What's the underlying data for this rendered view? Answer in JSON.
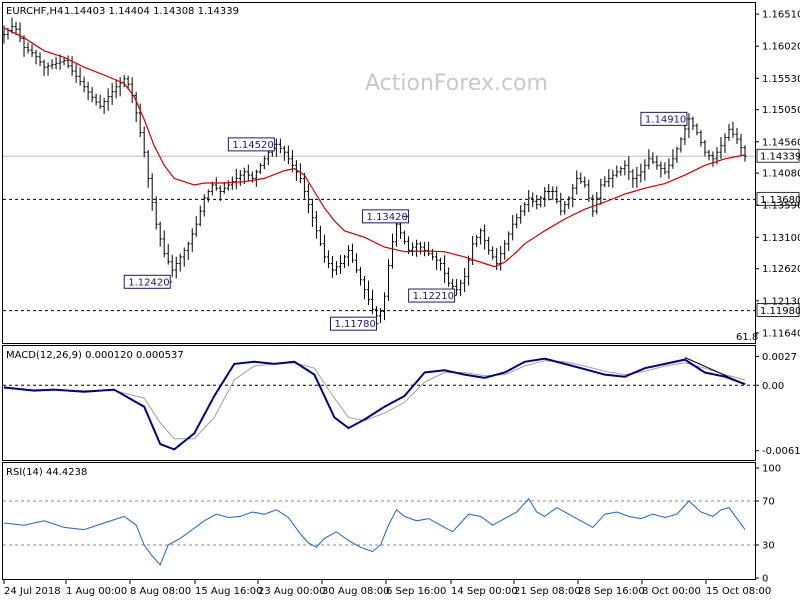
{
  "header": {
    "symbol": "EURCHF,H4",
    "ohlc": "1.14403 1.14404 1.14308 1.14339",
    "macd_label": "MACD(12,26,9) 0.000120 0.000537",
    "rsi_label": "RSI(14) 44.4238"
  },
  "watermark": "ActionForex.com",
  "colors": {
    "price_bar": "#000000",
    "ma": "#cc0000",
    "macd_main": "#000080",
    "macd_signal": "#a0a0a0",
    "rsi": "#1e64c8",
    "label_border": "#1a1a6e",
    "grid_dashed": "#000000"
  },
  "chart_data": [
    {
      "type": "ohlc",
      "title": "EURCHF,H4",
      "y_ticks": [
        "1.16510",
        "1.16020",
        "1.15530",
        "1.15050",
        "1.14560",
        "1.14080",
        "1.13590",
        "1.13100",
        "1.12620",
        "1.12130",
        "1.11640"
      ],
      "y_range": [
        1.115,
        1.1665
      ],
      "current_price": {
        "value": 1.14339,
        "label": "1.14339"
      },
      "horizontal_levels": [
        {
          "value": 1.1368,
          "label": "1.13680"
        },
        {
          "value": 1.1198,
          "label": "1.11980"
        }
      ],
      "annotations": [
        {
          "label": "1.14520",
          "value": 1.1452
        },
        {
          "label": "1.12420",
          "value": 1.1242
        },
        {
          "label": "1.13420",
          "value": 1.1342
        },
        {
          "label": "1.11780",
          "value": 1.1178
        },
        {
          "label": "1.12210",
          "value": 1.1221
        },
        {
          "label": "1.14910",
          "value": 1.1491
        }
      ],
      "fib_label": "61.8",
      "close_path": [
        [
          0,
          1.162
        ],
        [
          5,
          1.1635
        ],
        [
          10,
          1.16
        ],
        [
          15,
          1.159
        ],
        [
          20,
          1.157
        ],
        [
          25,
          1.1575
        ],
        [
          30,
          1.158
        ],
        [
          35,
          1.156
        ],
        [
          40,
          1.154
        ],
        [
          45,
          1.152
        ],
        [
          48,
          1.151
        ],
        [
          52,
          1.1525
        ],
        [
          56,
          1.154
        ],
        [
          60,
          1.1552
        ],
        [
          63,
          1.154
        ],
        [
          66,
          1.15
        ],
        [
          70,
          1.144
        ],
        [
          73,
          1.138
        ],
        [
          76,
          1.133
        ],
        [
          80,
          1.1285
        ],
        [
          84,
          1.126
        ],
        [
          88,
          1.128
        ],
        [
          92,
          1.13
        ],
        [
          96,
          1.133
        ],
        [
          100,
          1.137
        ],
        [
          104,
          1.139
        ],
        [
          108,
          1.138
        ],
        [
          112,
          1.139
        ],
        [
          116,
          1.14
        ],
        [
          120,
          1.141
        ],
        [
          124,
          1.14
        ],
        [
          128,
          1.142
        ],
        [
          132,
          1.144
        ],
        [
          136,
          1.1452
        ],
        [
          140,
          1.144
        ],
        [
          144,
          1.142
        ],
        [
          148,
          1.14
        ],
        [
          152,
          1.136
        ],
        [
          156,
          1.132
        ],
        [
          160,
          1.128
        ],
        [
          164,
          1.126
        ],
        [
          168,
          1.127
        ],
        [
          172,
          1.129
        ],
        [
          176,
          1.126
        ],
        [
          180,
          1.123
        ],
        [
          184,
          1.12
        ],
        [
          187,
          1.1185
        ],
        [
          190,
          1.122
        ],
        [
          193,
          1.129
        ],
        [
          196,
          1.133
        ],
        [
          199,
          1.131
        ],
        [
          202,
          1.129
        ],
        [
          206,
          1.13
        ],
        [
          210,
          1.129
        ],
        [
          214,
          1.128
        ],
        [
          218,
          1.127
        ],
        [
          222,
          1.124
        ],
        [
          226,
          1.123
        ],
        [
          230,
          1.125
        ],
        [
          234,
          1.13
        ],
        [
          238,
          1.132
        ],
        [
          242,
          1.129
        ],
        [
          246,
          1.127
        ],
        [
          250,
          1.13
        ],
        [
          254,
          1.133
        ],
        [
          258,
          1.135
        ],
        [
          262,
          1.137
        ],
        [
          266,
          1.136
        ],
        [
          270,
          1.138
        ],
        [
          274,
          1.138
        ],
        [
          278,
          1.135
        ],
        [
          282,
          1.137
        ],
        [
          286,
          1.14
        ],
        [
          290,
          1.139
        ],
        [
          294,
          1.135
        ],
        [
          298,
          1.139
        ],
        [
          302,
          1.14
        ],
        [
          306,
          1.141
        ],
        [
          310,
          1.142
        ],
        [
          314,
          1.14
        ],
        [
          318,
          1.141
        ],
        [
          322,
          1.143
        ],
        [
          326,
          1.142
        ],
        [
          330,
          1.141
        ],
        [
          334,
          1.143
        ],
        [
          338,
          1.146
        ],
        [
          342,
          1.1491
        ],
        [
          346,
          1.147
        ],
        [
          350,
          1.144
        ],
        [
          354,
          1.143
        ],
        [
          358,
          1.145
        ],
        [
          362,
          1.1475
        ],
        [
          366,
          1.146
        ],
        [
          370,
          1.1434
        ]
      ],
      "ma_path": [
        [
          0,
          1.163
        ],
        [
          10,
          1.1615
        ],
        [
          20,
          1.1595
        ],
        [
          30,
          1.1585
        ],
        [
          40,
          1.157
        ],
        [
          50,
          1.1558
        ],
        [
          60,
          1.1545
        ],
        [
          65,
          1.1525
        ],
        [
          70,
          1.149
        ],
        [
          75,
          1.145
        ],
        [
          80,
          1.142
        ],
        [
          85,
          1.14
        ],
        [
          90,
          1.1395
        ],
        [
          95,
          1.139
        ],
        [
          100,
          1.1393
        ],
        [
          110,
          1.1393
        ],
        [
          120,
          1.1395
        ],
        [
          130,
          1.14
        ],
        [
          140,
          1.1412
        ],
        [
          145,
          1.1415
        ],
        [
          150,
          1.1405
        ],
        [
          155,
          1.138
        ],
        [
          160,
          1.1355
        ],
        [
          165,
          1.1335
        ],
        [
          170,
          1.132
        ],
        [
          180,
          1.131
        ],
        [
          190,
          1.1295
        ],
        [
          200,
          1.1288
        ],
        [
          210,
          1.1289
        ],
        [
          220,
          1.1288
        ],
        [
          230,
          1.128
        ],
        [
          240,
          1.127
        ],
        [
          245,
          1.1265
        ],
        [
          250,
          1.1272
        ],
        [
          255,
          1.1285
        ],
        [
          260,
          1.13
        ],
        [
          270,
          1.132
        ],
        [
          280,
          1.1338
        ],
        [
          290,
          1.1353
        ],
        [
          300,
          1.1364
        ],
        [
          310,
          1.1376
        ],
        [
          320,
          1.1385
        ],
        [
          330,
          1.1392
        ],
        [
          340,
          1.1405
        ],
        [
          350,
          1.142
        ],
        [
          360,
          1.143
        ],
        [
          370,
          1.1436
        ]
      ]
    },
    {
      "type": "line",
      "title": "MACD(12,26,9) 0.000120 0.000537",
      "y_ticks": [
        "0.0027",
        "0.00",
        "-0.006114"
      ],
      "y_range": [
        -0.0068,
        0.0033
      ],
      "series": [
        {
          "name": "MACD",
          "values": [
            [
              0,
              -0.0002
            ],
            [
              15,
              -0.0005
            ],
            [
              25,
              -0.0004
            ],
            [
              40,
              -0.0006
            ],
            [
              55,
              -0.0004
            ],
            [
              70,
              -0.002
            ],
            [
              78,
              -0.0055
            ],
            [
              85,
              -0.006
            ],
            [
              95,
              -0.0045
            ],
            [
              105,
              -0.001
            ],
            [
              115,
              0.002
            ],
            [
              125,
              0.0022
            ],
            [
              135,
              0.002
            ],
            [
              145,
              0.0022
            ],
            [
              155,
              0.001
            ],
            [
              165,
              -0.003
            ],
            [
              172,
              -0.004
            ],
            [
              180,
              -0.0032
            ],
            [
              190,
              -0.002
            ],
            [
              200,
              -0.001
            ],
            [
              210,
              0.0012
            ],
            [
              220,
              0.0014
            ],
            [
              230,
              0.001
            ],
            [
              240,
              0.0007
            ],
            [
              250,
              0.0012
            ],
            [
              260,
              0.0022
            ],
            [
              270,
              0.0025
            ],
            [
              280,
              0.002
            ],
            [
              290,
              0.0015
            ],
            [
              300,
              0.001
            ],
            [
              310,
              0.0008
            ],
            [
              320,
              0.0016
            ],
            [
              330,
              0.002
            ],
            [
              340,
              0.0024
            ],
            [
              350,
              0.0012
            ],
            [
              360,
              0.0008
            ],
            [
              370,
              0.0001
            ]
          ]
        },
        {
          "name": "Signal",
          "values": [
            [
              0,
              -0.0003
            ],
            [
              15,
              -0.0004
            ],
            [
              25,
              -0.0004
            ],
            [
              40,
              -0.0005
            ],
            [
              55,
              -0.0005
            ],
            [
              70,
              -0.0012
            ],
            [
              78,
              -0.0035
            ],
            [
              85,
              -0.005
            ],
            [
              95,
              -0.005
            ],
            [
              105,
              -0.003
            ],
            [
              115,
              0.0005
            ],
            [
              125,
              0.0018
            ],
            [
              135,
              0.002
            ],
            [
              145,
              0.0021
            ],
            [
              155,
              0.0016
            ],
            [
              165,
              -0.0012
            ],
            [
              172,
              -0.003
            ],
            [
              180,
              -0.0033
            ],
            [
              190,
              -0.0026
            ],
            [
              200,
              -0.0016
            ],
            [
              210,
              0.0003
            ],
            [
              220,
              0.0012
            ],
            [
              230,
              0.0012
            ],
            [
              240,
              0.0009
            ],
            [
              250,
              0.001
            ],
            [
              260,
              0.0018
            ],
            [
              270,
              0.0023
            ],
            [
              280,
              0.0022
            ],
            [
              290,
              0.0018
            ],
            [
              300,
              0.0013
            ],
            [
              310,
              0.001
            ],
            [
              320,
              0.0013
            ],
            [
              330,
              0.0018
            ],
            [
              340,
              0.0021
            ],
            [
              350,
              0.0016
            ],
            [
              360,
              0.001
            ],
            [
              370,
              0.0005
            ]
          ]
        }
      ]
    },
    {
      "type": "line",
      "title": "RSI(14) 44.4238",
      "y_ticks": [
        "100",
        "70",
        "30",
        "0"
      ],
      "y_range": [
        0,
        100
      ],
      "levels": [
        70,
        30
      ],
      "series": [
        {
          "name": "RSI",
          "values": [
            [
              0,
              50
            ],
            [
              10,
              48
            ],
            [
              20,
              52
            ],
            [
              30,
              46
            ],
            [
              40,
              44
            ],
            [
              50,
              50
            ],
            [
              60,
              56
            ],
            [
              66,
              48
            ],
            [
              70,
              30
            ],
            [
              74,
              20
            ],
            [
              78,
              12
            ],
            [
              82,
              30
            ],
            [
              88,
              36
            ],
            [
              94,
              44
            ],
            [
              100,
              52
            ],
            [
              106,
              58
            ],
            [
              112,
              55
            ],
            [
              118,
              56
            ],
            [
              124,
              60
            ],
            [
              130,
              58
            ],
            [
              136,
              62
            ],
            [
              142,
              55
            ],
            [
              148,
              40
            ],
            [
              152,
              32
            ],
            [
              156,
              28
            ],
            [
              160,
              36
            ],
            [
              166,
              42
            ],
            [
              172,
              34
            ],
            [
              178,
              28
            ],
            [
              184,
              24
            ],
            [
              188,
              30
            ],
            [
              192,
              48
            ],
            [
              196,
              62
            ],
            [
              200,
              56
            ],
            [
              206,
              52
            ],
            [
              212,
              54
            ],
            [
              218,
              48
            ],
            [
              224,
              42
            ],
            [
              228,
              50
            ],
            [
              232,
              58
            ],
            [
              238,
              56
            ],
            [
              244,
              48
            ],
            [
              250,
              54
            ],
            [
              256,
              60
            ],
            [
              262,
              72
            ],
            [
              266,
              60
            ],
            [
              270,
              56
            ],
            [
              276,
              64
            ],
            [
              282,
              58
            ],
            [
              288,
              52
            ],
            [
              294,
              46
            ],
            [
              300,
              58
            ],
            [
              306,
              60
            ],
            [
              312,
              56
            ],
            [
              318,
              54
            ],
            [
              324,
              58
            ],
            [
              330,
              55
            ],
            [
              336,
              58
            ],
            [
              342,
              70
            ],
            [
              348,
              60
            ],
            [
              354,
              56
            ],
            [
              358,
              62
            ],
            [
              362,
              64
            ],
            [
              366,
              54
            ],
            [
              370,
              44
            ]
          ]
        }
      ]
    }
  ],
  "x_axis": {
    "labels": [
      "24 Jul 2018",
      "1 Aug 00:00",
      "8 Aug 08:00",
      "15 Aug 16:00",
      "23 Aug 00:00",
      "30 Aug 08:00",
      "6 Sep 16:00",
      "14 Sep 00:00",
      "21 Sep 08:00",
      "28 Sep 16:00",
      "8 Oct 00:00",
      "15 Oct 08:00"
    ]
  }
}
